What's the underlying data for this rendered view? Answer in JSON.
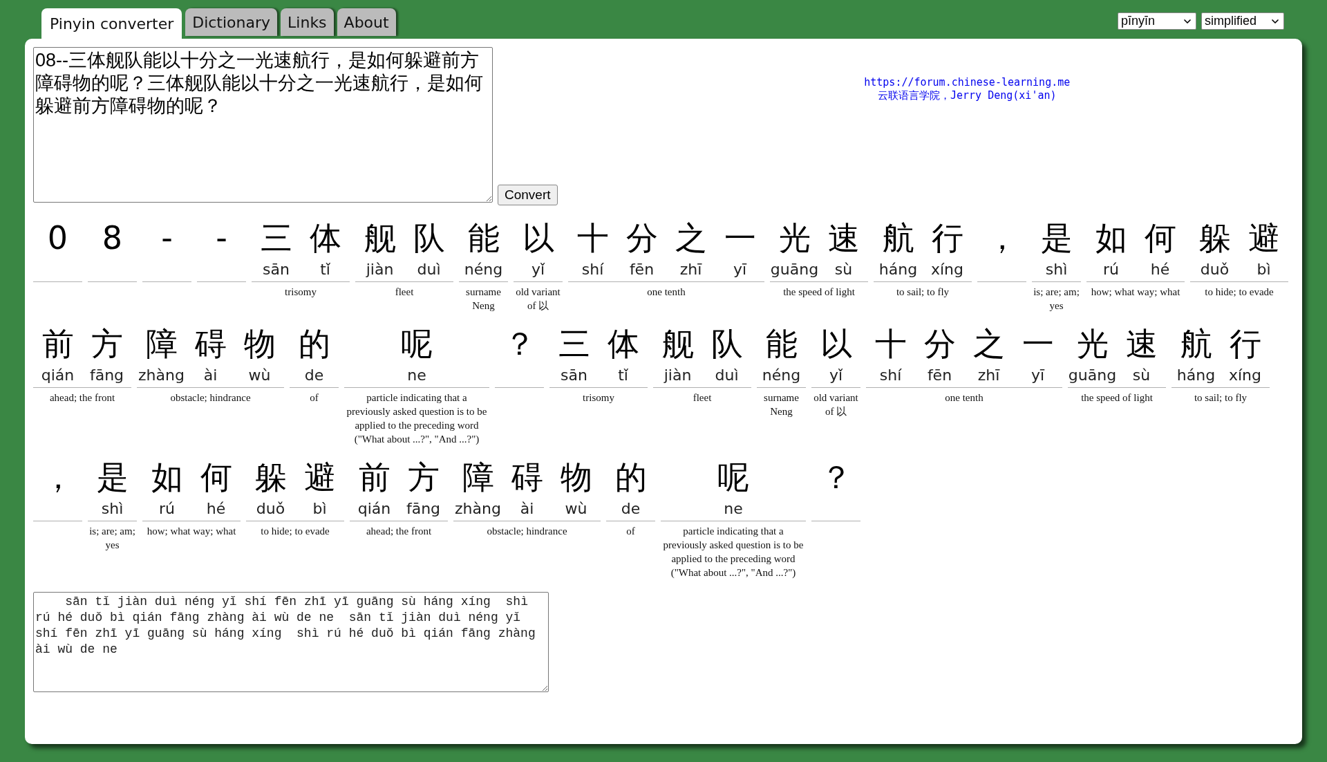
{
  "tabs": [
    {
      "label": "Pinyin converter",
      "selected": true
    },
    {
      "label": "Dictionary",
      "selected": false
    },
    {
      "label": "Links",
      "selected": false
    },
    {
      "label": "About",
      "selected": false
    }
  ],
  "selects": [
    {
      "value": "pīnyīn"
    },
    {
      "value": "simplified"
    }
  ],
  "input": {
    "value": "08--三体舰队能以十分之一光速航行，是如何躲避前方障碍物的呢？三体舰队能以十分之一光速航行，是如何躲避前方障碍物的呢？"
  },
  "convert_button": "Convert",
  "credits": {
    "url": "https://forum.chinese-learning.me",
    "author": "云联语言学院，Jerry Deng(xi'an)"
  },
  "words": [
    {
      "chars": [
        {
          "hanzi": "0"
        }
      ]
    },
    {
      "chars": [
        {
          "hanzi": "8"
        }
      ]
    },
    {
      "chars": [
        {
          "hanzi": "-"
        }
      ]
    },
    {
      "chars": [
        {
          "hanzi": "-"
        }
      ]
    },
    {
      "chars": [
        {
          "hanzi": "三",
          "pinyin": "sān"
        },
        {
          "hanzi": "体",
          "pinyin": "tǐ"
        }
      ],
      "definition": "trisomy"
    },
    {
      "chars": [
        {
          "hanzi": "舰",
          "pinyin": "jiàn"
        },
        {
          "hanzi": "队",
          "pinyin": "duì"
        }
      ],
      "definition": "fleet"
    },
    {
      "chars": [
        {
          "hanzi": "能",
          "pinyin": "néng"
        }
      ],
      "definition": "surname Neng"
    },
    {
      "chars": [
        {
          "hanzi": "以",
          "pinyin": "yǐ"
        }
      ],
      "definition": "old variant of 以"
    },
    {
      "chars": [
        {
          "hanzi": "十",
          "pinyin": "shí"
        },
        {
          "hanzi": "分",
          "pinyin": "fēn"
        },
        {
          "hanzi": "之",
          "pinyin": "zhī"
        },
        {
          "hanzi": "一",
          "pinyin": "yī"
        }
      ],
      "definition": "one tenth"
    },
    {
      "chars": [
        {
          "hanzi": "光",
          "pinyin": "guāng"
        },
        {
          "hanzi": "速",
          "pinyin": "sù"
        }
      ],
      "definition": "the speed of light"
    },
    {
      "chars": [
        {
          "hanzi": "航",
          "pinyin": "háng"
        },
        {
          "hanzi": "行",
          "pinyin": "xíng"
        }
      ],
      "definition": "to sail; to fly"
    },
    {
      "chars": [
        {
          "hanzi": "，"
        }
      ]
    },
    {
      "chars": [
        {
          "hanzi": "是",
          "pinyin": "shì"
        }
      ],
      "definition": "is; are; am; yes"
    },
    {
      "chars": [
        {
          "hanzi": "如",
          "pinyin": "rú"
        },
        {
          "hanzi": "何",
          "pinyin": "hé"
        }
      ],
      "definition": "how; what way; what"
    },
    {
      "chars": [
        {
          "hanzi": "躲",
          "pinyin": "duǒ"
        },
        {
          "hanzi": "避",
          "pinyin": "bì"
        }
      ],
      "definition": "to hide; to evade"
    },
    {
      "chars": [
        {
          "hanzi": "前",
          "pinyin": "qián"
        },
        {
          "hanzi": "方",
          "pinyin": "fāng"
        }
      ],
      "definition": "ahead; the front"
    },
    {
      "chars": [
        {
          "hanzi": "障",
          "pinyin": "zhàng"
        },
        {
          "hanzi": "碍",
          "pinyin": "ài"
        },
        {
          "hanzi": "物",
          "pinyin": "wù"
        }
      ],
      "definition": "obstacle; hindrance"
    },
    {
      "chars": [
        {
          "hanzi": "的",
          "pinyin": "de"
        }
      ],
      "definition": "of"
    },
    {
      "chars": [
        {
          "hanzi": "呢",
          "pinyin": "ne"
        }
      ],
      "definition": "particle indicating that a previously asked question is to be applied to the preceding word (\"What about ...?\", \"And ...?\")"
    },
    {
      "chars": [
        {
          "hanzi": "？"
        }
      ]
    },
    {
      "chars": [
        {
          "hanzi": "三",
          "pinyin": "sān"
        },
        {
          "hanzi": "体",
          "pinyin": "tǐ"
        }
      ],
      "definition": "trisomy"
    },
    {
      "chars": [
        {
          "hanzi": "舰",
          "pinyin": "jiàn"
        },
        {
          "hanzi": "队",
          "pinyin": "duì"
        }
      ],
      "definition": "fleet"
    },
    {
      "chars": [
        {
          "hanzi": "能",
          "pinyin": "néng"
        }
      ],
      "definition": "surname Neng"
    },
    {
      "chars": [
        {
          "hanzi": "以",
          "pinyin": "yǐ"
        }
      ],
      "definition": "old variant of 以"
    },
    {
      "chars": [
        {
          "hanzi": "十",
          "pinyin": "shí"
        },
        {
          "hanzi": "分",
          "pinyin": "fēn"
        },
        {
          "hanzi": "之",
          "pinyin": "zhī"
        },
        {
          "hanzi": "一",
          "pinyin": "yī"
        }
      ],
      "definition": "one tenth"
    },
    {
      "chars": [
        {
          "hanzi": "光",
          "pinyin": "guāng"
        },
        {
          "hanzi": "速",
          "pinyin": "sù"
        }
      ],
      "definition": "the speed of light"
    },
    {
      "chars": [
        {
          "hanzi": "航",
          "pinyin": "háng"
        },
        {
          "hanzi": "行",
          "pinyin": "xíng"
        }
      ],
      "definition": "to sail; to fly"
    },
    {
      "chars": [
        {
          "hanzi": "，"
        }
      ]
    },
    {
      "chars": [
        {
          "hanzi": "是",
          "pinyin": "shì"
        }
      ],
      "definition": "is; are; am; yes"
    },
    {
      "chars": [
        {
          "hanzi": "如",
          "pinyin": "rú"
        },
        {
          "hanzi": "何",
          "pinyin": "hé"
        }
      ],
      "definition": "how; what way; what"
    },
    {
      "chars": [
        {
          "hanzi": "躲",
          "pinyin": "duǒ"
        },
        {
          "hanzi": "避",
          "pinyin": "bì"
        }
      ],
      "definition": "to hide; to evade"
    },
    {
      "chars": [
        {
          "hanzi": "前",
          "pinyin": "qián"
        },
        {
          "hanzi": "方",
          "pinyin": "fāng"
        }
      ],
      "definition": "ahead; the front"
    },
    {
      "chars": [
        {
          "hanzi": "障",
          "pinyin": "zhàng"
        },
        {
          "hanzi": "碍",
          "pinyin": "ài"
        },
        {
          "hanzi": "物",
          "pinyin": "wù"
        }
      ],
      "definition": "obstacle; hindrance"
    },
    {
      "chars": [
        {
          "hanzi": "的",
          "pinyin": "de"
        }
      ],
      "definition": "of"
    },
    {
      "chars": [
        {
          "hanzi": "呢",
          "pinyin": "ne"
        }
      ],
      "definition": "particle indicating that a previously asked question is to be applied to the preceding word (\"What about ...?\", \"And ...?\")"
    },
    {
      "chars": [
        {
          "hanzi": "？"
        }
      ]
    }
  ],
  "output": {
    "value": "    sān tǐ jiàn duì néng yǐ shí fēn zhī yī guāng sù háng xíng  shì rú hé duǒ bì qián fāng zhàng ài wù de ne  sān tǐ jiàn duì néng yǐ shí fēn zhī yī guāng sù háng xíng  shì rú hé duǒ bì qián fāng zhàng ài wù de ne"
  }
}
